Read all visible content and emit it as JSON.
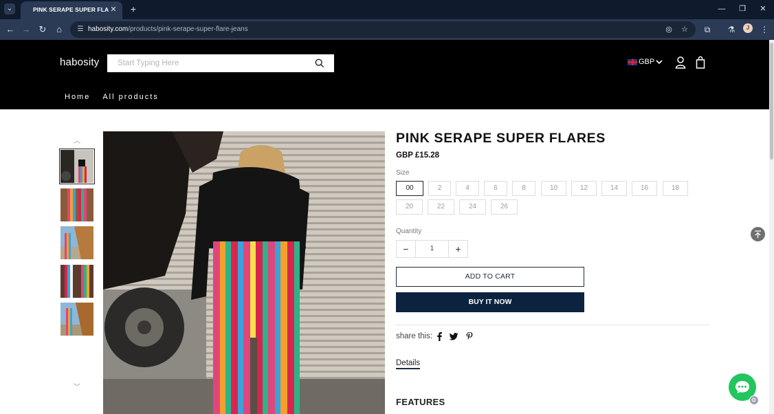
{
  "browser": {
    "tab_title": "PINK SERAPE SUPER FLARES -",
    "tab_close": "✕",
    "new_tab": "+",
    "url_host": "habosity.com",
    "url_path": "/products/pink-serape-super-flare-jeans",
    "profile_initial": "J",
    "icons": [
      "tab-search-icon",
      "back-icon",
      "forward-icon",
      "reload-icon",
      "home-icon",
      "site-info-icon",
      "eye-off-icon",
      "star-icon",
      "extensions-icon",
      "labs-icon",
      "profile-icon",
      "menu-icon",
      "minimize-icon",
      "maximize-icon",
      "close-icon"
    ]
  },
  "header": {
    "logo": "habosity",
    "search_placeholder": "Start Typing Here",
    "currency": "GBP",
    "nav": [
      "Home",
      "All products"
    ]
  },
  "product": {
    "title": "PINK SERAPE SUPER FLARES",
    "price": "GBP £15.28",
    "size_label": "Size",
    "sizes": [
      "00",
      "2",
      "4",
      "6",
      "8",
      "10",
      "12",
      "14",
      "16",
      "18",
      "20",
      "22",
      "24",
      "26"
    ],
    "selected_size": "00",
    "quantity_label": "Quantity",
    "quantity": "1",
    "qty_minus": "−",
    "qty_plus": "+",
    "add_to_cart": "ADD TO CART",
    "buy_now": "BUY IT NOW",
    "share_label": "share this:",
    "details_tab": "Details",
    "features_heading": "FEATURES"
  },
  "gallery": {
    "thumb_count": 5,
    "active_thumb": 0
  },
  "colors": {
    "header_bg": "#000000",
    "buy_button": "#0c2340",
    "chat_bubble": "#22c55e"
  }
}
